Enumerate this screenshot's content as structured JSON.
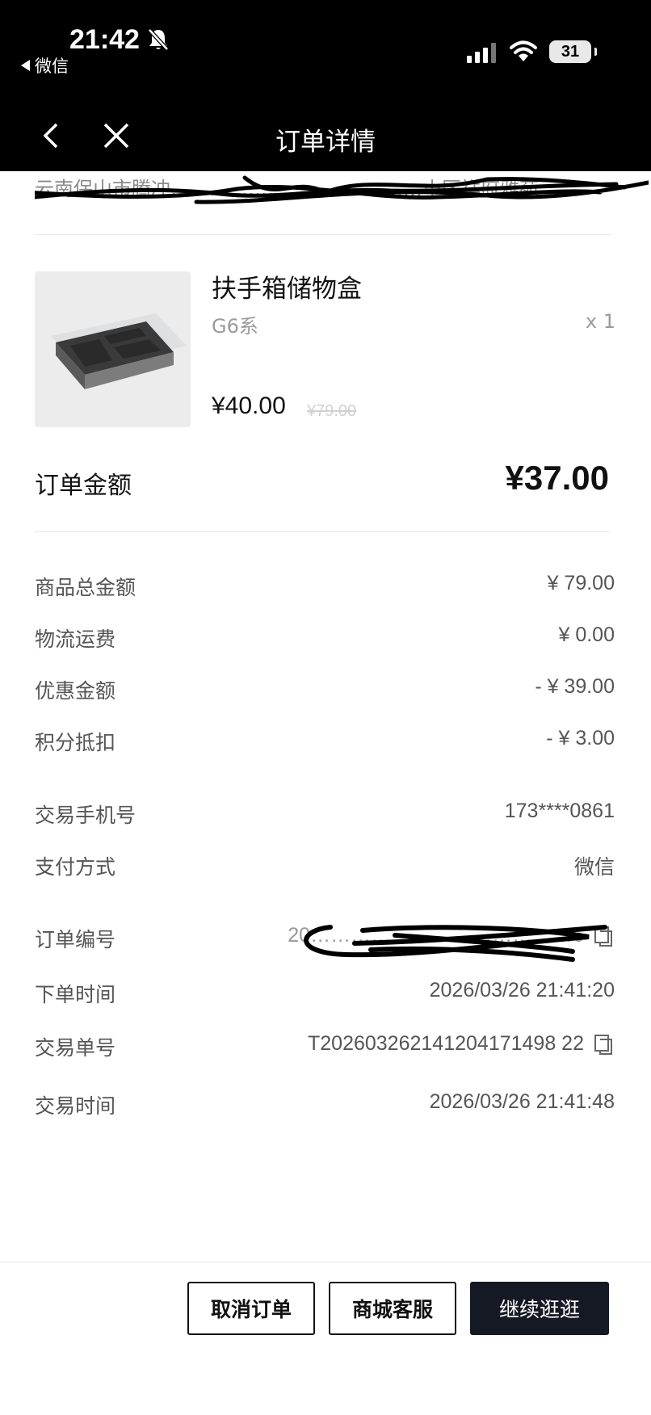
{
  "status_bar": {
    "time": "21:42",
    "back_app": "微信",
    "battery": "31"
  },
  "nav": {
    "title": "订单详情"
  },
  "address": {
    "text": "云南保山市腾冲…………………………………小区祥府雅苑"
  },
  "product": {
    "name": "扶手箱储物盒",
    "variant": "G6系",
    "quantity": "x 1",
    "price": "¥40.00",
    "original_price": "¥79.00"
  },
  "order_total": {
    "label": "订单金额",
    "value": "¥37.00"
  },
  "price_breakdown": [
    {
      "label": "商品总金额",
      "value": "¥ 79.00"
    },
    {
      "label": "物流运费",
      "value": "¥ 0.00"
    },
    {
      "label": "优惠金额",
      "value": "- ¥ 39.00"
    },
    {
      "label": "积分抵扣",
      "value": "- ¥ 3.00"
    }
  ],
  "payment_info": [
    {
      "label": "交易手机号",
      "value": "173****0861"
    },
    {
      "label": "支付方式",
      "value": "微信"
    }
  ],
  "order_info": {
    "order_no_label": "订单编号",
    "order_no_value": "20…………………………………6",
    "order_time_label": "下单时间",
    "order_time_value": "2026/03/26 21:41:20",
    "trade_no_label": "交易单号",
    "trade_no_value": "T202603262141204171498 22",
    "trade_time_label": "交易时间",
    "trade_time_value": "2026/03/26 21:41:48"
  },
  "actions": {
    "cancel": "取消订单",
    "service": "商城客服",
    "continue": "继续逛逛"
  },
  "colors": {
    "top_bar": "#000000",
    "primary_button": "#141923",
    "muted_text": "#555555"
  },
  "icons": [
    "bell-slash-icon",
    "signal-icon",
    "wifi-icon",
    "battery-icon",
    "back-arrow-icon",
    "close-icon",
    "copy-icon"
  ]
}
